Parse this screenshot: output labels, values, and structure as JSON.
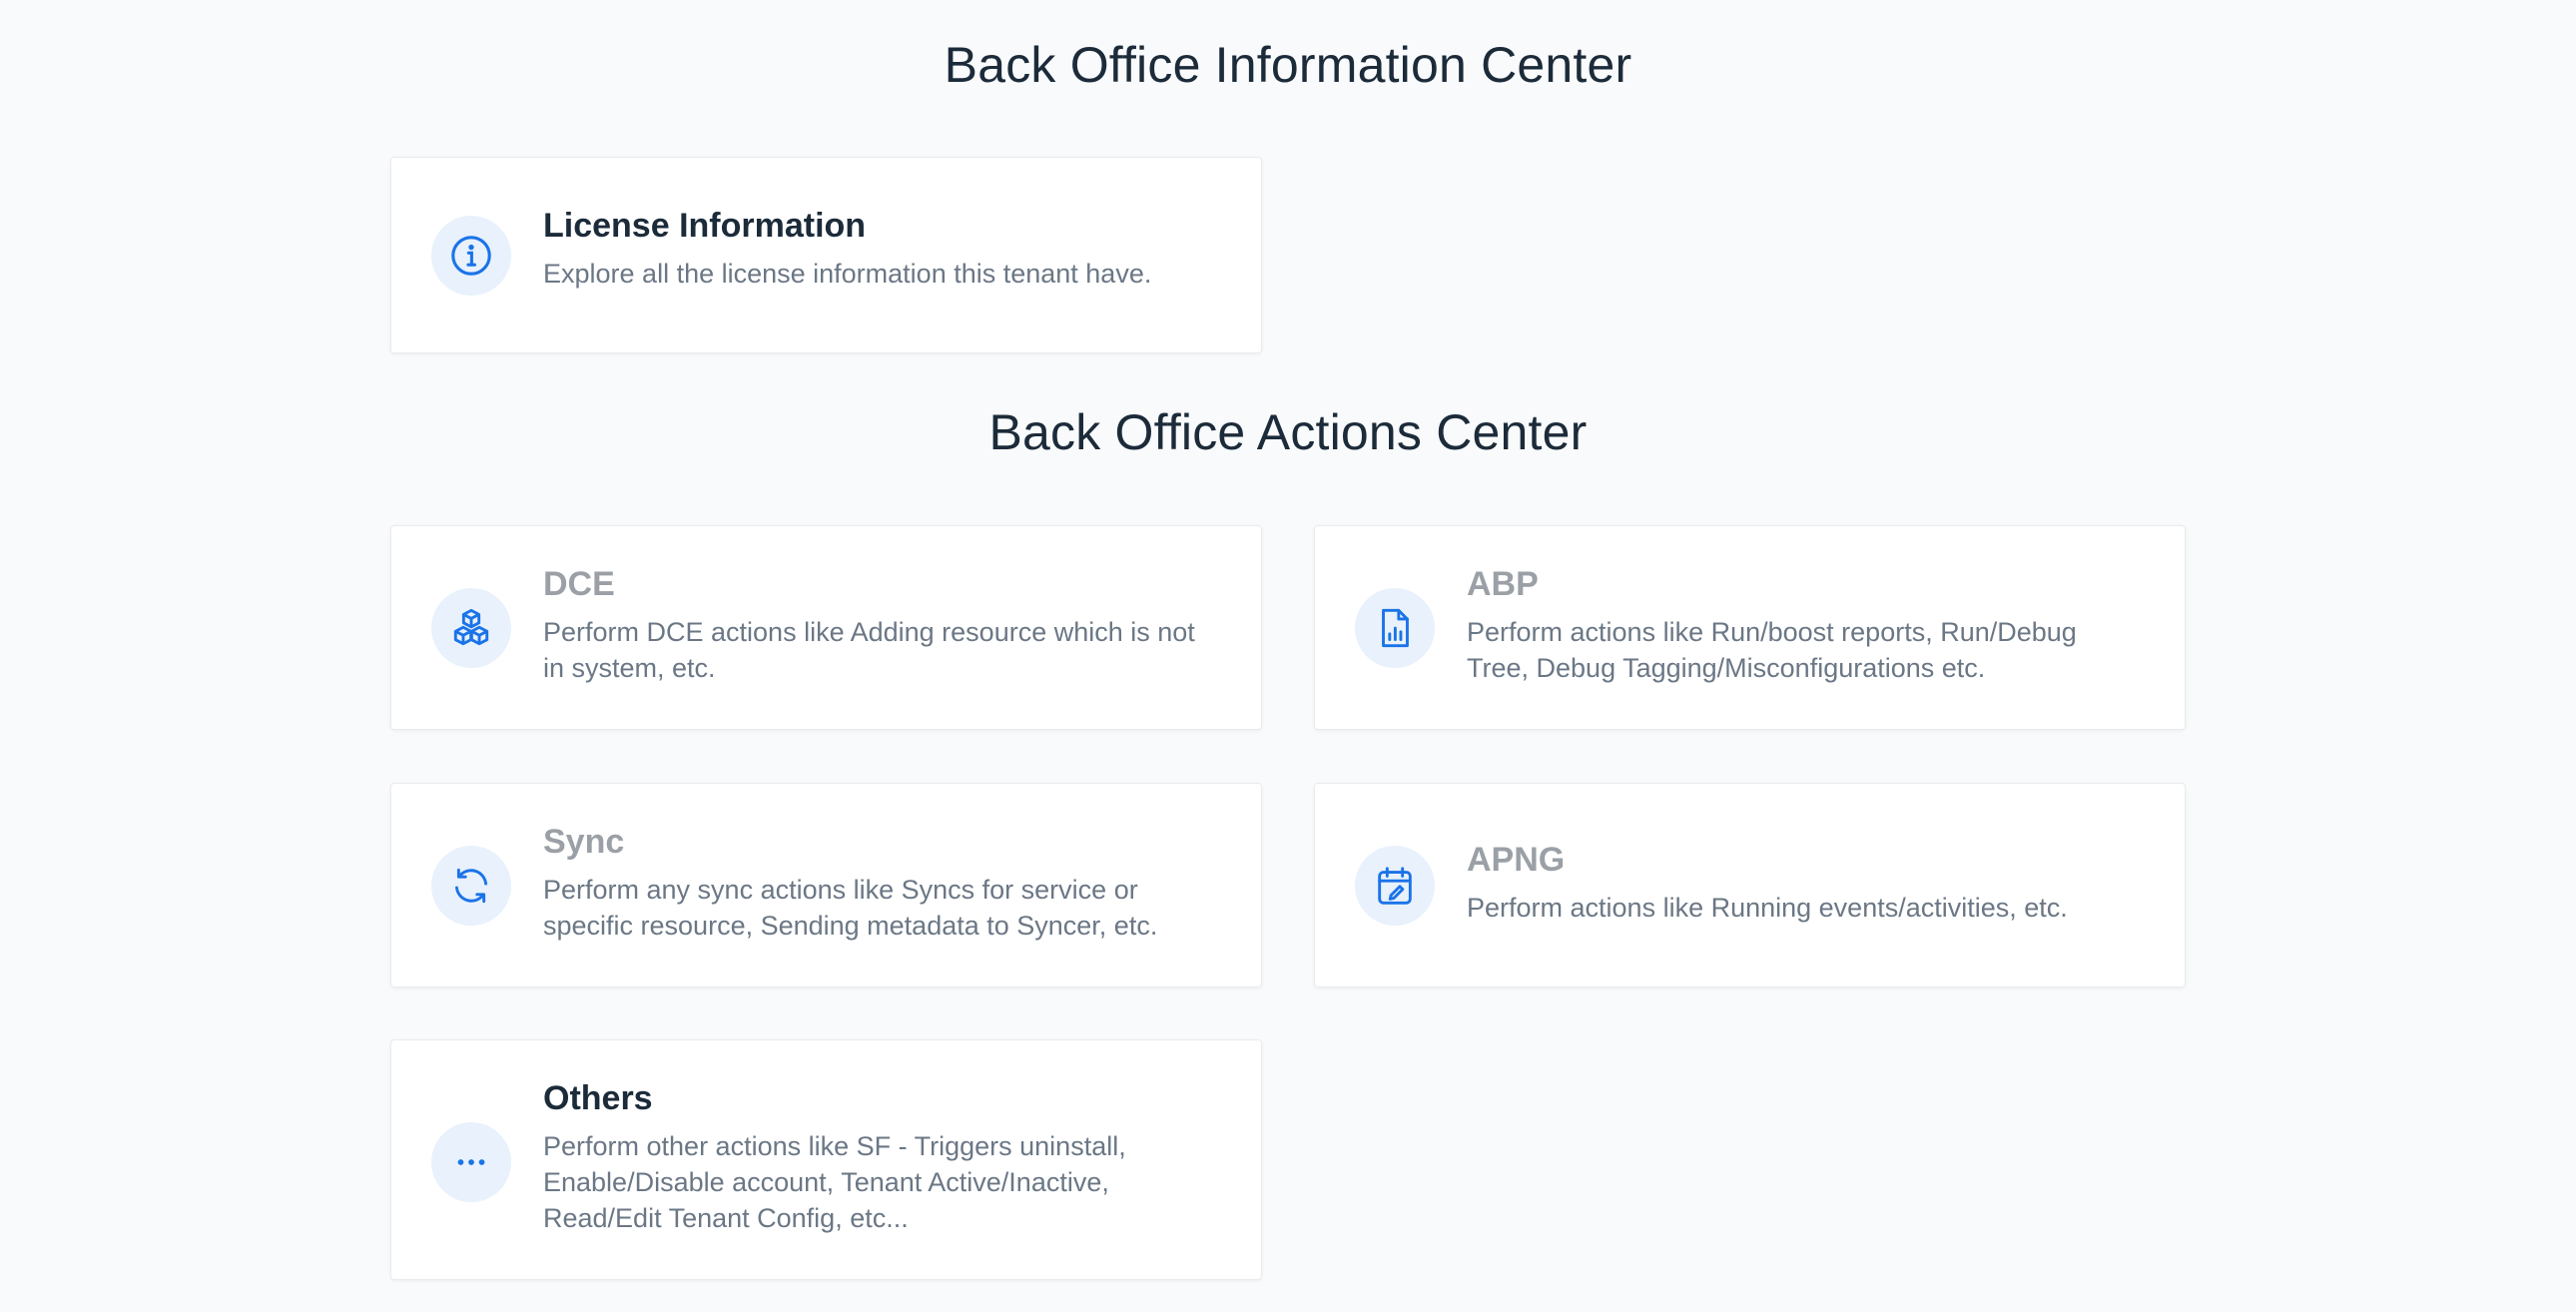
{
  "info_center": {
    "title": "Back Office Information Center",
    "cards": [
      {
        "icon": "info-icon",
        "title": "License Information",
        "description": "Explore all the license information this tenant have."
      }
    ]
  },
  "actions_center": {
    "title": "Back Office Actions Center",
    "cards": [
      {
        "icon": "cubes-icon",
        "title": "DCE",
        "description": "Perform DCE actions like Adding resource which is not in system, etc."
      },
      {
        "icon": "report-icon",
        "title": "ABP",
        "description": "Perform actions like Run/boost reports, Run/Debug Tree, Debug Tagging/Misconfigurations etc."
      },
      {
        "icon": "sync-icon",
        "title": "Sync",
        "description": "Perform any sync actions like Syncs for service or specific resource, Sending metadata to Syncer, etc."
      },
      {
        "icon": "calendar-edit-icon",
        "title": "APNG",
        "description": "Perform actions like Running events/activities, etc."
      },
      {
        "icon": "more-icon",
        "title": "Others",
        "description": "Perform other actions like SF - Triggers uninstall, Enable/Disable account, Tenant Active/Inactive, Read/Edit Tenant Config, etc..."
      }
    ]
  },
  "colors": {
    "accent": "#1a73e8",
    "icon_bg": "#e8f1fc",
    "title_active": "#1c2b3a",
    "title_muted": "#9aa0a6",
    "description": "#6b7785",
    "page_bg": "#f9fafb"
  }
}
